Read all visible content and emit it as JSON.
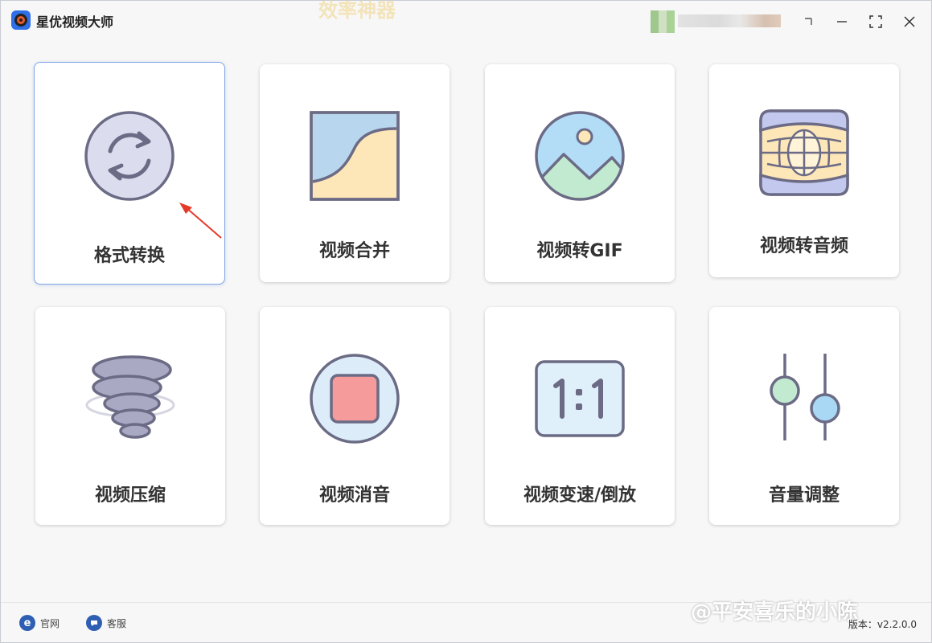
{
  "app": {
    "title": "星优视频大师",
    "top_ghost": "效率神器"
  },
  "tools": [
    {
      "label": "格式转换",
      "icon": "convert-icon"
    },
    {
      "label": "视频合并",
      "icon": "merge-icon"
    },
    {
      "label": "视频转GIF",
      "icon": "gif-icon"
    },
    {
      "label": "视频转音频",
      "icon": "audio-film-icon"
    },
    {
      "label": "视频压缩",
      "icon": "tornado-icon"
    },
    {
      "label": "视频消音",
      "icon": "stop-icon"
    },
    {
      "label": "视频变速/倒放",
      "icon": "ratio-icon"
    },
    {
      "label": "音量调整",
      "icon": "slider-icon"
    }
  ],
  "footer": {
    "website_label": "官网",
    "service_label": "客服",
    "version": "版本：v2.2.0.0"
  },
  "watermark": "@平安喜乐的小陈",
  "colors": {
    "accent": "#2f6fe8",
    "selected_border": "#7fa4e6",
    "icon_stroke": "#6b6b85"
  }
}
